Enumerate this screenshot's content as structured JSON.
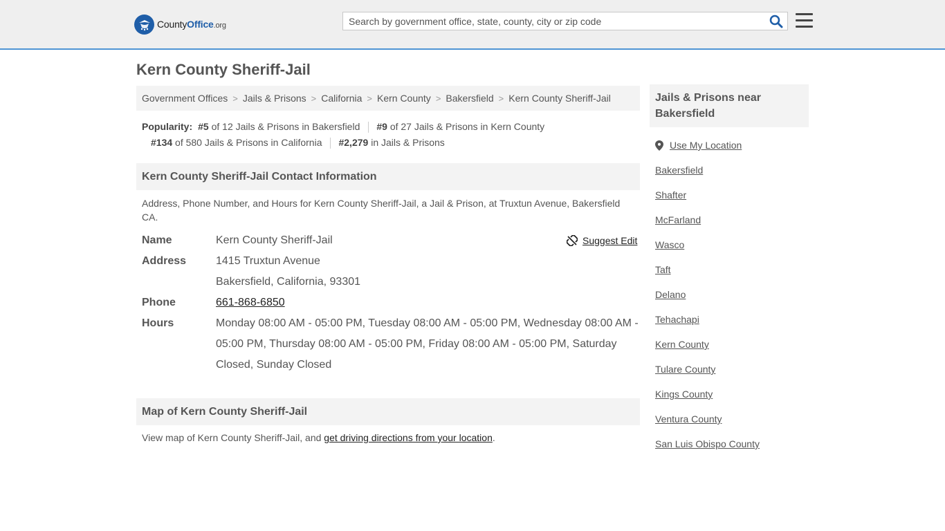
{
  "header": {
    "logo_main": "County",
    "logo_accent": "Office",
    "logo_tld": ".org",
    "search_placeholder": "Search by government office, state, county, city or zip code"
  },
  "page": {
    "title": "Kern County Sheriff-Jail",
    "breadcrumb": [
      "Government Offices",
      "Jails & Prisons",
      "California",
      "Kern County",
      "Bakersfield",
      "Kern County Sheriff-Jail"
    ],
    "popularity": {
      "label": "Popularity:",
      "items": [
        {
          "rank": "#5",
          "text": " of 12 Jails & Prisons in Bakersfield"
        },
        {
          "rank": "#9",
          "text": " of 27 Jails & Prisons in Kern County"
        },
        {
          "rank": "#134",
          "text": " of 580 Jails & Prisons in California"
        },
        {
          "rank": "#2,279",
          "text": " in Jails & Prisons"
        }
      ]
    }
  },
  "contact": {
    "heading": "Kern County Sheriff-Jail Contact Information",
    "description": "Address, Phone Number, and Hours for Kern County Sheriff-Jail, a Jail & Prison, at Truxtun Avenue, Bakersfield CA.",
    "suggest_edit": "Suggest Edit",
    "labels": {
      "name": "Name",
      "address": "Address",
      "phone": "Phone",
      "hours": "Hours"
    },
    "name": "Kern County Sheriff-Jail",
    "address_line1": "1415 Truxtun Avenue",
    "address_line2": "Bakersfield, California, 93301",
    "phone": "661-868-6850",
    "hours": "Monday 08:00 AM - 05:00 PM, Tuesday 08:00 AM - 05:00 PM, Wednesday 08:00 AM - 05:00 PM, Thursday 08:00 AM - 05:00 PM, Friday 08:00 AM - 05:00 PM, Saturday Closed, Sunday Closed"
  },
  "map": {
    "heading": "Map of Kern County Sheriff-Jail",
    "desc_prefix": "View map of Kern County Sheriff-Jail, and ",
    "desc_link": "get driving directions from your location",
    "desc_suffix": "."
  },
  "sidebar": {
    "heading": "Jails & Prisons near Bakersfield",
    "use_location": "Use My Location",
    "links": [
      "Bakersfield",
      "Shafter",
      "McFarland",
      "Wasco",
      "Taft",
      "Delano",
      "Tehachapi",
      "Kern County",
      "Tulare County",
      "Kings County",
      "Ventura County",
      "San Luis Obispo County"
    ]
  },
  "icons": {
    "logo": "seal-stars-icon",
    "search": "search-icon",
    "menu": "hamburger-menu-icon",
    "suggest": "broken-link-icon",
    "location": "map-pin-icon"
  },
  "colors": {
    "accent": "#1f5ea8",
    "header_border": "#4f94d4",
    "header_bg": "#efefef"
  }
}
